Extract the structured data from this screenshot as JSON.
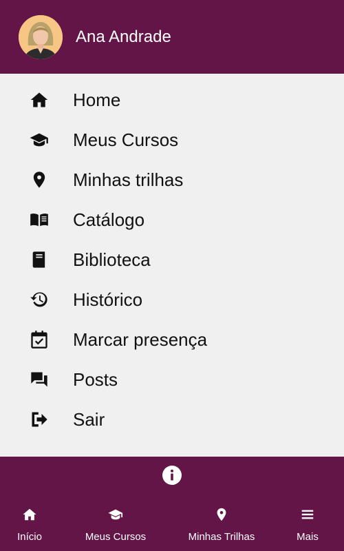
{
  "colors": {
    "brand": "#631547",
    "menu_bg": "#f0f0f0",
    "text": "#111111",
    "on_brand": "#ffffff"
  },
  "header": {
    "user_name": "Ana Andrade",
    "avatar_icon": "user-avatar"
  },
  "menu": {
    "items": [
      {
        "label": "Home",
        "icon": "home-icon"
      },
      {
        "label": "Meus Cursos",
        "icon": "graduation-cap-icon"
      },
      {
        "label": "Minhas trilhas",
        "icon": "map-pin-icon"
      },
      {
        "label": "Catálogo",
        "icon": "open-book-icon"
      },
      {
        "label": "Biblioteca",
        "icon": "book-icon"
      },
      {
        "label": "Histórico",
        "icon": "history-icon"
      },
      {
        "label": "Marcar presença",
        "icon": "calendar-check-icon"
      },
      {
        "label": "Posts",
        "icon": "chat-icon"
      },
      {
        "label": "Sair",
        "icon": "sign-out-icon"
      }
    ]
  },
  "info": {
    "icon": "info-icon"
  },
  "tabbar": {
    "tabs": [
      {
        "label": "Início",
        "icon": "home-icon"
      },
      {
        "label": "Meus Cursos",
        "icon": "graduation-cap-icon"
      },
      {
        "label": "Minhas Trilhas",
        "icon": "map-pin-icon"
      },
      {
        "label": "Mais",
        "icon": "menu-icon"
      }
    ]
  }
}
